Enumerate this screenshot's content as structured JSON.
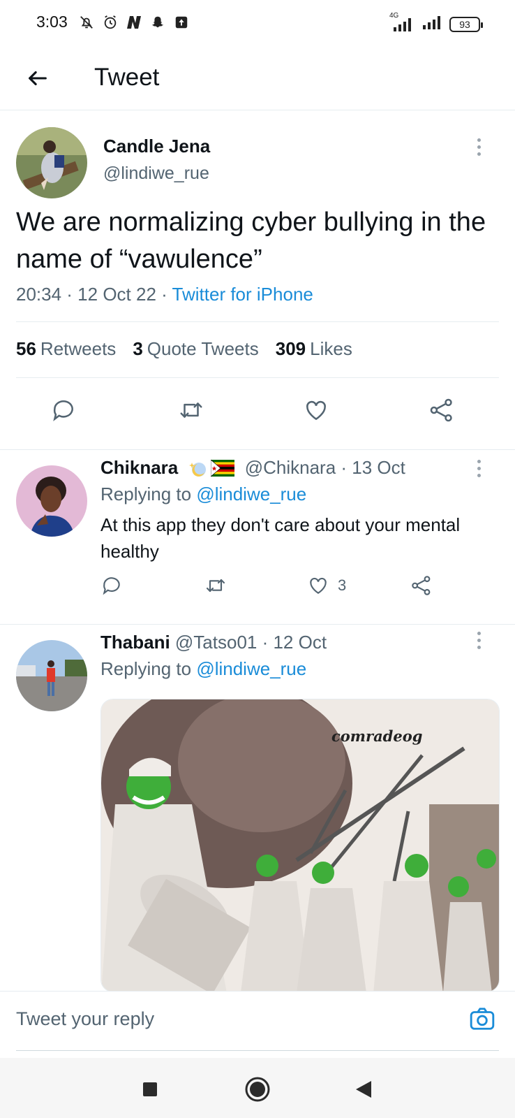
{
  "status_bar": {
    "time": "3:03",
    "network": "4G",
    "battery": "93"
  },
  "header": {
    "title": "Tweet",
    "back_icon": "arrow-left-icon"
  },
  "main_tweet": {
    "author_name": "Candle Jena",
    "author_handle": "@lindiwe_rue",
    "text": "We are normalizing cyber bullying in the name of “vawulence”",
    "timestamp": "20:34 · 12 Oct 22 · ",
    "source": "Twitter for iPhone",
    "stats": {
      "retweets_count": "56",
      "retweets_label": "Retweets",
      "quotes_count": "3",
      "quotes_label": "Quote Tweets",
      "likes_count": "309",
      "likes_label": "Likes"
    }
  },
  "replies": [
    {
      "name": "Chiknara",
      "handle_date": "@Chiknara · 13 Oct",
      "replying_prefix": "Replying to ",
      "replying_to": "@lindiwe_rue",
      "text": "At this app they don't care about your mental healthy",
      "like_count": "3"
    },
    {
      "name": "Thabani",
      "handle_date": "@Tatso01 · 12 Oct",
      "replying_prefix": "Replying to ",
      "replying_to": "@lindiwe_rue",
      "media_caption": "comradeog"
    }
  ],
  "composer": {
    "placeholder": "Tweet your reply"
  },
  "colors": {
    "accent": "#1a8cd8",
    "text": "#0f1419",
    "secondary": "#536471",
    "divider": "#e6ecf0"
  }
}
